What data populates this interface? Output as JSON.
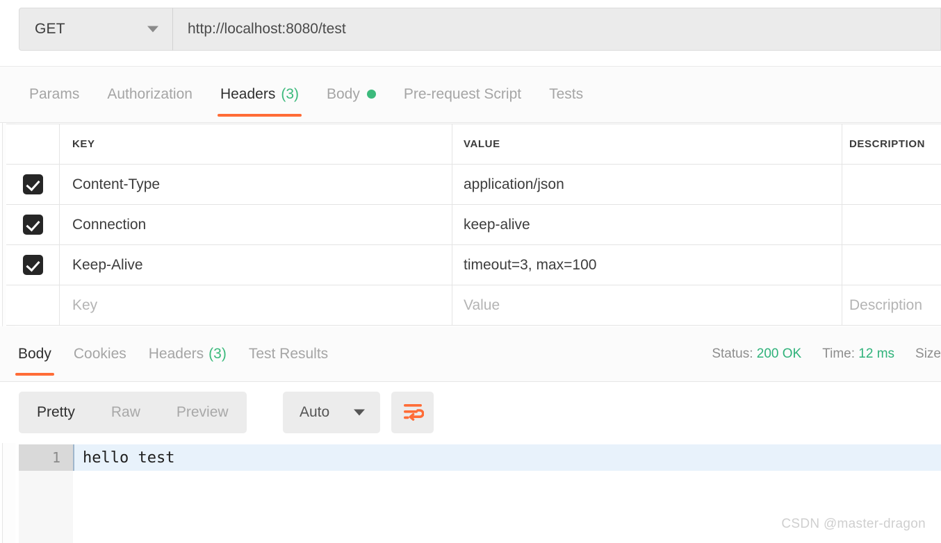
{
  "request": {
    "method": "GET",
    "method_caret_icon": "chevron-down-icon",
    "url": "http://localhost:8080/test",
    "tabs": [
      {
        "label": "Params",
        "count": null,
        "active": false,
        "dot": false
      },
      {
        "label": "Authorization",
        "count": null,
        "active": false,
        "dot": false
      },
      {
        "label": "Headers",
        "count": "(3)",
        "active": true,
        "dot": false
      },
      {
        "label": "Body",
        "count": null,
        "active": false,
        "dot": true
      },
      {
        "label": "Pre-request Script",
        "count": null,
        "active": false,
        "dot": false
      },
      {
        "label": "Tests",
        "count": null,
        "active": false,
        "dot": false
      }
    ]
  },
  "headers_table": {
    "columns": [
      "KEY",
      "VALUE",
      "DESCRIPTION"
    ],
    "rows": [
      {
        "checked": true,
        "key": "Content-Type",
        "value": "application/json",
        "description": ""
      },
      {
        "checked": true,
        "key": "Connection",
        "value": "keep-alive",
        "description": ""
      },
      {
        "checked": true,
        "key": "Keep-Alive",
        "value": "timeout=3, max=100",
        "description": ""
      }
    ],
    "placeholder_row": {
      "key": "Key",
      "value": "Value",
      "description": "Description"
    }
  },
  "response": {
    "tabs": [
      {
        "label": "Body",
        "count": null,
        "active": true
      },
      {
        "label": "Cookies",
        "count": null,
        "active": false
      },
      {
        "label": "Headers",
        "count": "(3)",
        "active": false
      },
      {
        "label": "Test Results",
        "count": null,
        "active": false
      }
    ],
    "meta": {
      "status_label": "Status:",
      "status_value": "200 OK",
      "time_label": "Time:",
      "time_value": "12 ms",
      "size_label": "Size"
    },
    "toolbar": {
      "view_modes": [
        {
          "label": "Pretty",
          "active": true
        },
        {
          "label": "Raw",
          "active": false
        },
        {
          "label": "Preview",
          "active": false
        }
      ],
      "format_selected": "Auto",
      "format_caret_icon": "chevron-down-icon",
      "wrap_icon": "word-wrap-icon"
    },
    "body": {
      "line_number": "1",
      "line_text": "hello test"
    }
  },
  "watermark": "CSDN @master-dragon",
  "colors": {
    "accent": "#ff6c37",
    "success": "#3cba7c",
    "status_green": "#2fb27a",
    "checkbox": "#262626",
    "muted": "#a5a5a5"
  }
}
